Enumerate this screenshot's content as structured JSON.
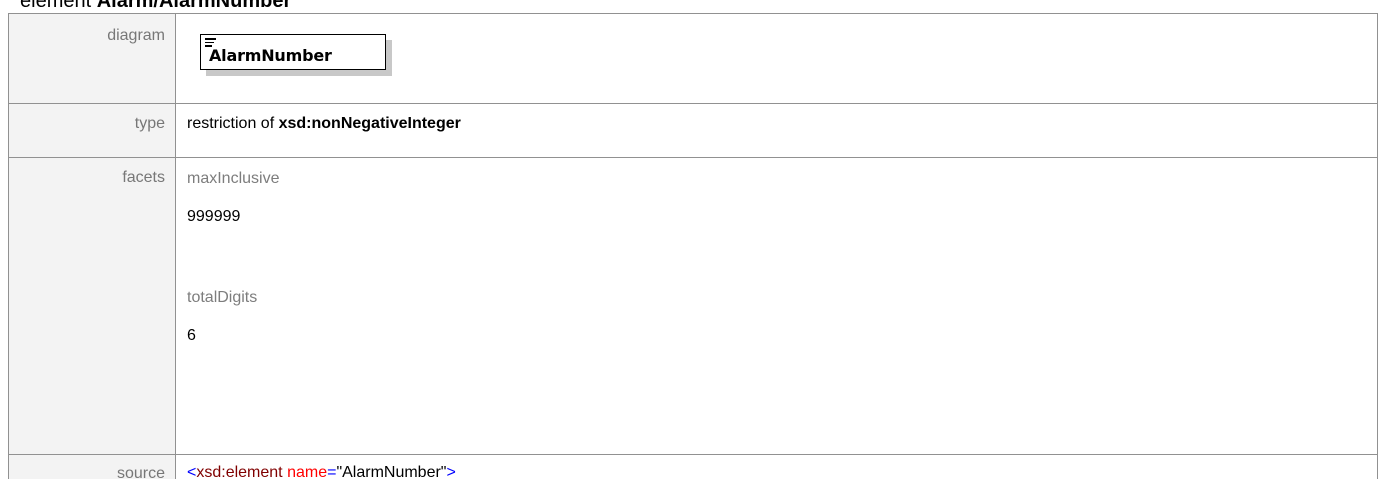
{
  "heading": {
    "prefix": "element ",
    "name": "Alarm/AlarmNumber"
  },
  "rows": {
    "diagram": {
      "label": "diagram",
      "element_name": "AlarmNumber"
    },
    "type": {
      "label": "type",
      "prefix": "restriction of ",
      "base_type": "xsd:nonNegativeInteger"
    },
    "facets": {
      "label": "facets",
      "items": [
        {
          "name": "maxInclusive",
          "value": "999999"
        },
        {
          "name": "totalDigits",
          "value": "6"
        }
      ]
    },
    "source": {
      "label": "source",
      "open_bracket": "<",
      "tag": "xsd:element",
      "space": " ",
      "attr": "name",
      "equals": "=",
      "value": "\"AlarmNumber\"",
      "close_bracket": ">"
    }
  },
  "colors": {
    "label_bg": "#f3f3f3",
    "border": "#919191",
    "xml_bracket": "#0000ff",
    "xml_tag": "#800000",
    "xml_attr": "#ff0000"
  },
  "icons": {
    "diagram_element": "element-lines-icon"
  }
}
